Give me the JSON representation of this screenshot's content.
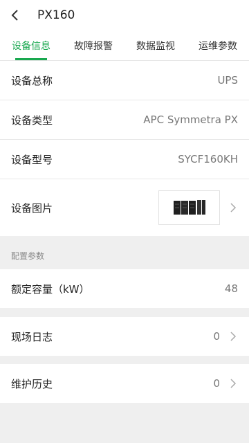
{
  "header": {
    "title": "PX160"
  },
  "tabs": [
    {
      "label": "设备信息",
      "active": true
    },
    {
      "label": "故障报警",
      "active": false
    },
    {
      "label": "数据监视",
      "active": false
    },
    {
      "label": "运维参数",
      "active": false
    }
  ],
  "device_info": {
    "name": {
      "label": "设备总称",
      "value": "UPS"
    },
    "type": {
      "label": "设备类型",
      "value": "APC Symmetra PX"
    },
    "model": {
      "label": "设备型号",
      "value": "SYCF160KH"
    },
    "image": {
      "label": "设备图片"
    }
  },
  "config": {
    "section_label": "配置参数",
    "capacity": {
      "label": "额定容量（kW）",
      "value": "48"
    }
  },
  "site_log": {
    "label": "现场日志",
    "value": "0"
  },
  "maintenance": {
    "label": "维护历史",
    "value": "0"
  },
  "colors": {
    "accent": "#19a84f",
    "background": "#efefef",
    "divider": "#e8e8e8"
  },
  "icons": [
    "back-arrow-icon",
    "chevron-right-icon",
    "ups-cabinet-image"
  ]
}
